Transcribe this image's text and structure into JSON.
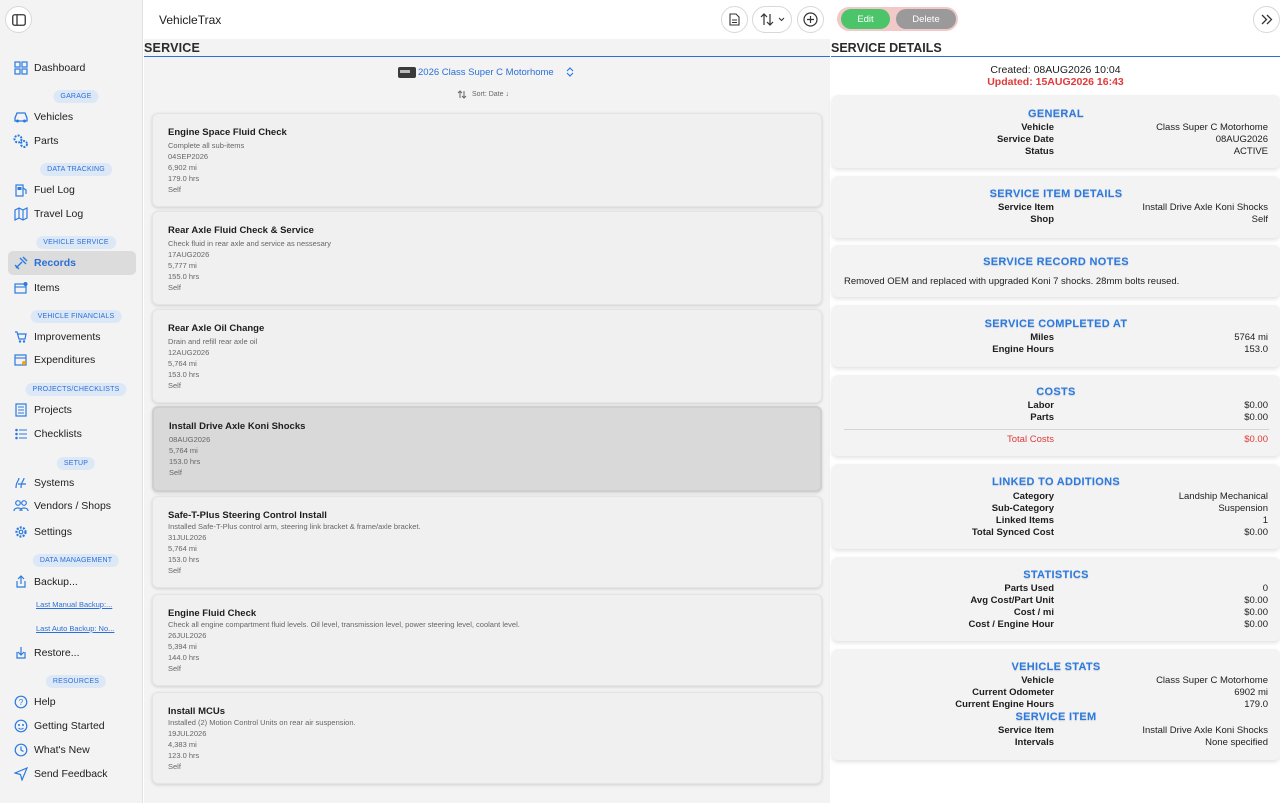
{
  "sidebar": {
    "items": [
      {
        "label": "Dashboard",
        "icon": "dashboard-icon"
      },
      {
        "label": "Vehicles",
        "icon": "car-icon"
      },
      {
        "label": "Parts",
        "icon": "gears-icon"
      },
      {
        "label": "Fuel Log",
        "icon": "fuel-icon"
      },
      {
        "label": "Travel Log",
        "icon": "map-icon"
      },
      {
        "label": "Records",
        "icon": "wrench-icon"
      },
      {
        "label": "Items",
        "icon": "calendar-icon"
      },
      {
        "label": "Improvements",
        "icon": "cart-icon"
      },
      {
        "label": "Expenditures",
        "icon": "expenditures-icon"
      },
      {
        "label": "Projects",
        "icon": "projects-icon"
      },
      {
        "label": "Checklists",
        "icon": "checklist-icon"
      },
      {
        "label": "Systems",
        "icon": "systems-icon"
      },
      {
        "label": "Vendors / Shops",
        "icon": "vendors-icon"
      },
      {
        "label": "Settings",
        "icon": "gear-icon"
      },
      {
        "label": "Backup...",
        "icon": "upload-icon"
      },
      {
        "label": "Restore...",
        "icon": "download-icon"
      },
      {
        "label": "Help",
        "icon": "help-icon"
      },
      {
        "label": "Getting Started",
        "icon": "getting-started-icon"
      },
      {
        "label": "What's New",
        "icon": "clock-icon"
      },
      {
        "label": "Send Feedback",
        "icon": "send-icon"
      }
    ],
    "sections": [
      "GARAGE",
      "DATA TRACKING",
      "VEHICLE SERVICE",
      "VEHICLE FINANCIALS",
      "PROJECTS/CHECKLISTS",
      "SETUP",
      "DATA MANAGEMENT",
      "RESOURCES"
    ],
    "links": {
      "last_manual_backup": "Last Manual Backup:...",
      "last_auto_backup": "Last Auto Backup: No..."
    }
  },
  "header": {
    "app_title": "VehicleTrax"
  },
  "service": {
    "section_title": "SERVICE",
    "vehicle": "2026 Class Super C Motorhome",
    "sort_label": "Sort: Date ↓",
    "records": [
      {
        "title": "Engine Space Fluid Check",
        "desc": "Complete all sub-items",
        "date": "04SEP2026",
        "miles": "6,902 mi",
        "hours": "179.0 hrs",
        "by": "Self"
      },
      {
        "title": "Rear Axle Fluid Check & Service",
        "desc": "Check fluid in rear axle and service as nessesary",
        "date": "17AUG2026",
        "miles": "5,777 mi",
        "hours": "155.0 hrs",
        "by": "Self"
      },
      {
        "title": "Rear Axle Oil Change",
        "desc": "Drain and refill rear axle oil",
        "date": "12AUG2026",
        "miles": "5,764 mi",
        "hours": "153.0 hrs",
        "by": "Self"
      },
      {
        "title": "Install Drive Axle Koni Shocks",
        "date": "08AUG2026",
        "miles": "5,764 mi",
        "hours": "153.0 hrs",
        "by": "Self"
      },
      {
        "title": "Safe-T-Plus Steering Control Install",
        "desc": "Installed Safe-T-Plus control arm, steering link bracket & frame/axle bracket.",
        "date": "31JUL2026",
        "miles": "5,764 mi",
        "hours": "153.0 hrs",
        "by": "Self"
      },
      {
        "title": "Engine Fluid Check",
        "desc": "Check all engine compartment fluid levels. Oil level, transmission level, power steering level, coolant level.",
        "date": "26JUL2026",
        "miles": "5,394 mi",
        "hours": "144.0 hrs",
        "by": "Self"
      },
      {
        "title": "Install MCUs",
        "desc": "Installed (2) Motion Control Units on rear air suspension.",
        "date": "19JUL2026",
        "miles": "4,383 mi",
        "hours": "123.0 hrs",
        "by": "Self"
      }
    ]
  },
  "detail": {
    "edit_label": "Edit",
    "delete_label": "Delete",
    "section_title": "SERVICE DETAILS",
    "created": "Created: 08AUG2026 10:04",
    "updated": "Updated: 15AUG2026 16:43",
    "general": {
      "title": "GENERAL",
      "rows": [
        {
          "k": "Vehicle",
          "v": "Class Super C Motorhome"
        },
        {
          "k": "Service Date",
          "v": "08AUG2026"
        },
        {
          "k": "Status",
          "v": "ACTIVE"
        }
      ]
    },
    "item_details": {
      "title": "SERVICE ITEM DETAILS",
      "rows": [
        {
          "k": "Service Item",
          "v": "Install Drive Axle Koni Shocks"
        },
        {
          "k": "Shop",
          "v": "Self"
        }
      ]
    },
    "notes": {
      "title": "SERVICE RECORD NOTES",
      "text": "Removed OEM and replaced with upgraded Koni 7 shocks.  28mm bolts reused."
    },
    "completed": {
      "title": "SERVICE COMPLETED AT",
      "rows": [
        {
          "k": "Miles",
          "v": "5764 mi"
        },
        {
          "k": "Engine Hours",
          "v": "153.0"
        }
      ]
    },
    "costs": {
      "title": "COSTS",
      "rows": [
        {
          "k": "Labor",
          "v": "$0.00"
        },
        {
          "k": "Parts",
          "v": "$0.00"
        }
      ],
      "total_label": "Total Costs",
      "total_value": "$0.00"
    },
    "linked": {
      "title": "LINKED TO ADDITIONS",
      "rows": [
        {
          "k": "Category",
          "v": "Landship Mechanical"
        },
        {
          "k": "Sub-Category",
          "v": "Suspension"
        },
        {
          "k": "Linked Items",
          "v": "1"
        },
        {
          "k": "Total Synced Cost",
          "v": "$0.00"
        }
      ]
    },
    "statistics": {
      "title": "STATISTICS",
      "rows": [
        {
          "k": "Parts Used",
          "v": "0"
        },
        {
          "k": "Avg Cost/Part Unit",
          "v": "$0.00"
        },
        {
          "k": "Cost / mi",
          "v": "$0.00"
        },
        {
          "k": "Cost / Engine Hour",
          "v": "$0.00"
        }
      ]
    },
    "vehicle_stats": {
      "title": "VEHICLE STATS",
      "rows": [
        {
          "k": "Vehicle",
          "v": "Class Super C Motorhome"
        },
        {
          "k": "Current Odometer",
          "v": "6902 mi"
        },
        {
          "k": "Current Engine Hours",
          "v": "179.0"
        }
      ]
    },
    "service_item": {
      "title": "SERVICE ITEM",
      "rows": [
        {
          "k": "Service Item",
          "v": "Install Drive Axle Koni Shocks"
        },
        {
          "k": "Intervals",
          "v": "None specified"
        }
      ]
    }
  },
  "colors": {
    "accent": "#2a7ae2",
    "danger": "#e03a3a",
    "edit": "#4cc46a",
    "delete": "#9a9a9a",
    "selected": "#d9d9d9"
  }
}
